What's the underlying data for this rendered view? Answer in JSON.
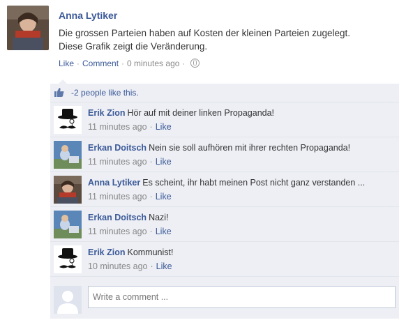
{
  "post": {
    "author": "Anna Lytiker",
    "text_line1": "Die grossen Parteien haben auf Kosten der kleinen Parteien zugelegt.",
    "text_line2": "Diese Grafik zeigt die Veränderung.",
    "like_label": "Like",
    "comment_label": "Comment",
    "timestamp": "0 minutes ago",
    "privacy_icon": "globe-icon"
  },
  "likes": {
    "text": "-2 people like this.",
    "icon": "thumbs-up-icon"
  },
  "comments": [
    {
      "author": "Erik Zion",
      "text": "Hör auf mit deiner linken Propaganda!",
      "time": "11 minutes ago",
      "like": "Like",
      "avatar": "hat-mustache-avatar"
    },
    {
      "author": "Erkan Doitsch",
      "text": "Nein sie soll aufhören mit ihrer rechten Propaganda!",
      "time": "11 minutes ago",
      "like": "Like",
      "avatar": "photo-avatar"
    },
    {
      "author": "Anna Lytiker",
      "text": "Es scheint, ihr habt meinen Post nicht ganz verstanden ...",
      "time": "11 minutes ago",
      "like": "Like",
      "avatar": "photo-avatar"
    },
    {
      "author": "Erkan Doitsch",
      "text": "Nazi!",
      "time": "11 minutes ago",
      "like": "Like",
      "avatar": "photo-avatar"
    },
    {
      "author": "Erik Zion",
      "text": "Kommunist!",
      "time": "10 minutes ago",
      "like": "Like",
      "avatar": "hat-mustache-avatar"
    }
  ],
  "compose": {
    "placeholder": "Write a comment ..."
  },
  "colors": {
    "link": "#3b5998",
    "feedback_bg": "#edeff4",
    "muted": "#888888"
  }
}
